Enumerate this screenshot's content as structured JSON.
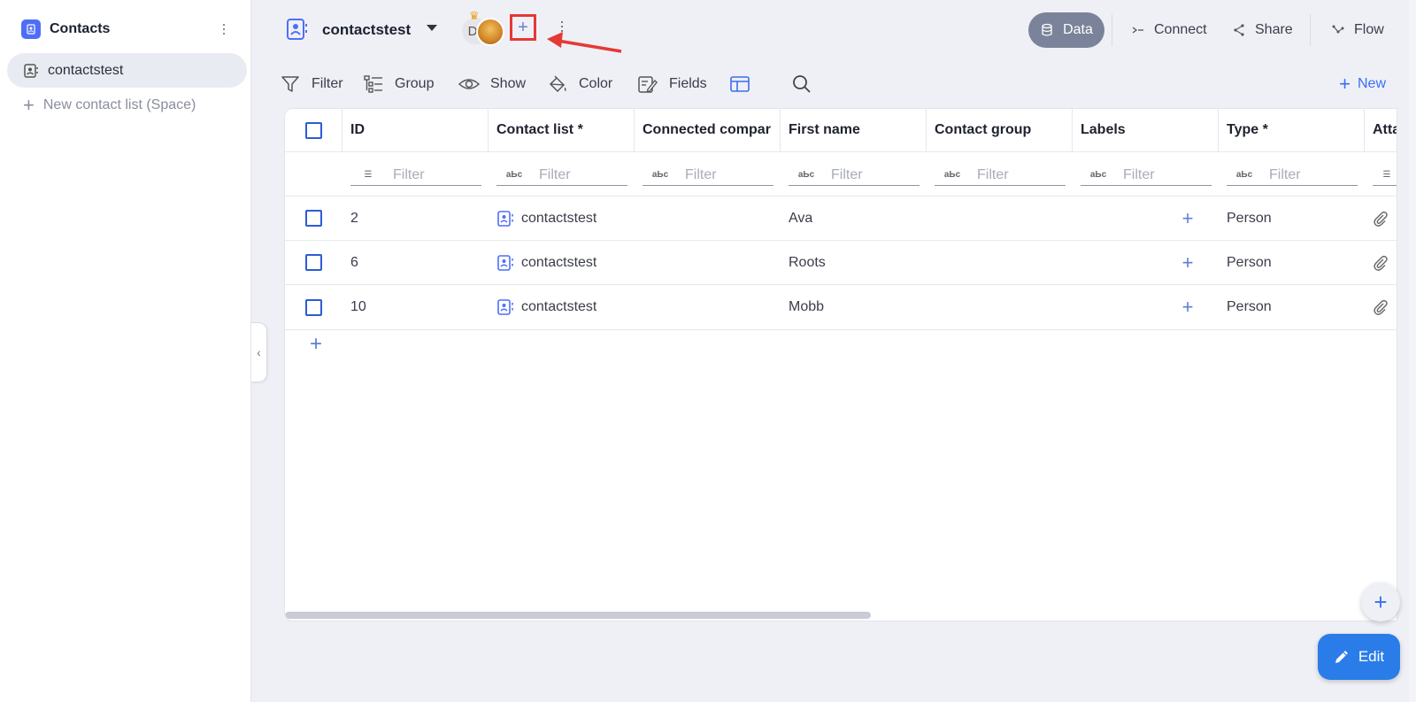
{
  "sidebar": {
    "title": "Contacts",
    "items": [
      {
        "label": "contactstest"
      }
    ],
    "new_label": "New contact list (Space)"
  },
  "topbar": {
    "space_name": "contactstest",
    "avatar_initial": "D",
    "add_member_icon": "plus-icon",
    "buttons": {
      "data": "Data",
      "connect": "Connect",
      "share": "Share",
      "flow": "Flow"
    }
  },
  "toolbar": {
    "filter": "Filter",
    "group": "Group",
    "show": "Show",
    "color": "Color",
    "fields": "Fields",
    "new": "New"
  },
  "table": {
    "columns": [
      "ID",
      "Contact list *",
      "Connected compar",
      "First name",
      "Contact group",
      "Labels",
      "Type *",
      "Atta"
    ],
    "filter_placeholder": "Filter",
    "rows": [
      {
        "id": "2",
        "contact_list": "contactstest",
        "first_name": "Ava",
        "type": "Person"
      },
      {
        "id": "6",
        "contact_list": "contactstest",
        "first_name": "Roots",
        "type": "Person"
      },
      {
        "id": "10",
        "contact_list": "contactstest",
        "first_name": "Mobb",
        "type": "Person"
      }
    ]
  },
  "actions": {
    "edit": "Edit"
  },
  "colors": {
    "accent": "#3b6ef2",
    "highlight_box": "#e53935",
    "data_button": "#7a8399"
  }
}
